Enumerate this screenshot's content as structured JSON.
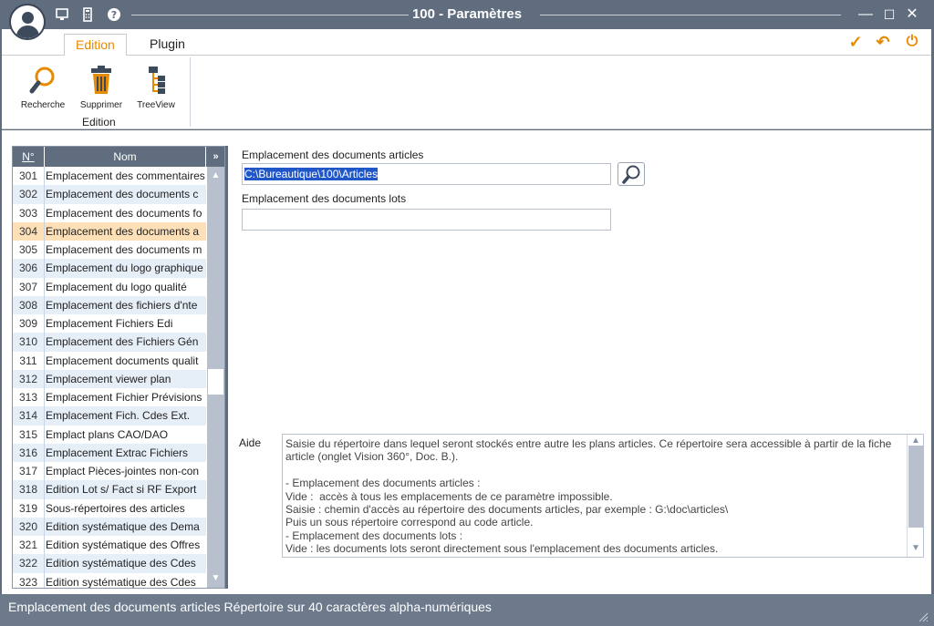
{
  "window": {
    "title": "100 - Paramètres",
    "minimize": "—",
    "maximize": "☐",
    "close": "✕"
  },
  "titlebar_icons": [
    "monitor-icon",
    "calculator-icon",
    "help-icon"
  ],
  "ribbon": {
    "tabs": [
      {
        "label": "Edition",
        "active": true
      },
      {
        "label": "Plugin",
        "active": false
      }
    ],
    "buttons": [
      {
        "label": "Recherche",
        "icon": "search-icon"
      },
      {
        "label": "Supprimer",
        "icon": "trash-icon"
      },
      {
        "label": "TreeView",
        "icon": "treeview-icon"
      }
    ],
    "group_label": "Edition",
    "actions": {
      "validate": "✓",
      "undo": "↶",
      "power": "⏻"
    }
  },
  "list": {
    "col_num": "N°",
    "col_name": "Nom",
    "rows": [
      {
        "num": "301",
        "name": "Emplacement des commentaires"
      },
      {
        "num": "302",
        "name": "Emplacement des documents c"
      },
      {
        "num": "303",
        "name": "Emplacement des documents fo"
      },
      {
        "num": "304",
        "name": "Emplacement des documents a",
        "selected": true
      },
      {
        "num": "305",
        "name": "Emplacement des documents m"
      },
      {
        "num": "306",
        "name": "Emplacement du logo graphique"
      },
      {
        "num": "307",
        "name": "Emplacement du logo qualité"
      },
      {
        "num": "308",
        "name": "Emplacement des fichiers d'nte"
      },
      {
        "num": "309",
        "name": "Emplacement Fichiers Edi"
      },
      {
        "num": "310",
        "name": "Emplacement des Fichiers Gén"
      },
      {
        "num": "311",
        "name": "Emplacement documents qualit"
      },
      {
        "num": "312",
        "name": "Emplacement viewer plan"
      },
      {
        "num": "313",
        "name": "Emplacement Fichier Prévisions"
      },
      {
        "num": "314",
        "name": "Emplacement Fich. Cdes Ext."
      },
      {
        "num": "315",
        "name": "Emplact plans CAO/DAO"
      },
      {
        "num": "316",
        "name": "Emplacement Extrac Fichiers"
      },
      {
        "num": "317",
        "name": "Emplact Pièces-jointes non-con"
      },
      {
        "num": "318",
        "name": "Edition Lot s/ Fact si RF Export"
      },
      {
        "num": "319",
        "name": "Sous-répertoires des articles"
      },
      {
        "num": "320",
        "name": "Edition systématique des Dema"
      },
      {
        "num": "321",
        "name": "Edition systématique des Offres"
      },
      {
        "num": "322",
        "name": "Edition systématique des Cdes"
      },
      {
        "num": "323",
        "name": "Edition systématique des Cdes"
      }
    ]
  },
  "form": {
    "field1_label": "Emplacement des documents articles",
    "field1_value": "C:\\Bureautique\\100\\Articles",
    "field2_label": "Emplacement des documents lots",
    "field2_value": "",
    "aide_label": "Aide",
    "aide_text": "Saisie du répertoire dans lequel seront stockés entre autre les plans articles. Ce répertoire sera accessible à partir de la fiche article (onglet Vision 360°, Doc. B.).\n\n- Emplacement des documents articles :\nVide :  accès à tous les emplacements de ce paramètre impossible.\nSaisie : chemin d'accès au répertoire des documents articles, par exemple : G:\\doc\\articles\\\nPuis un sous répertoire correspond au code article.\n- Emplacement des documents lots :\nVide : les documents lots seront directement sous l'emplacement des documents articles."
  },
  "status": {
    "text": "Emplacement des documents articles Répertoire sur 40 caractères alpha-numériques"
  },
  "colors": {
    "chrome": "#5f6d7f",
    "accent": "#e88a00",
    "selection": "#fde0b8",
    "highlight": "#1f56c8"
  }
}
